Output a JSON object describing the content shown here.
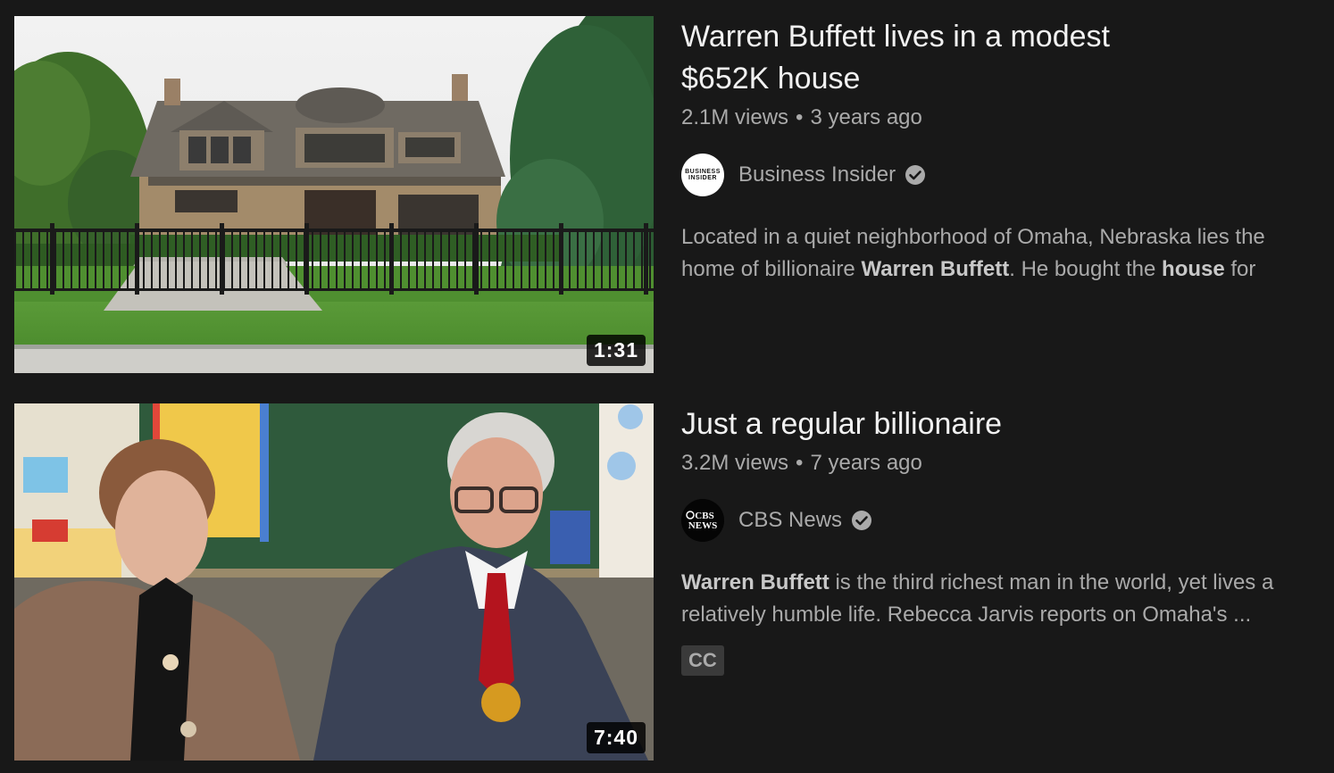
{
  "videos": [
    {
      "title_line1": "Warren Buffett lives in a modest",
      "title_line2": "$652K house",
      "views": "2.1M views",
      "separator": "•",
      "age": "3 years ago",
      "channel": "Business Insider",
      "avatar_text_line1": "BUSINESS",
      "avatar_text_line2": "INSIDER",
      "verified_icon": "verified-check-icon",
      "description_parts": [
        "Located in a quiet neighborhood of Omaha, Nebraska lies the home of billionaire ",
        "Warren Buffett",
        ". He bought the ",
        "house",
        " for"
      ],
      "duration": "1:31"
    },
    {
      "title_line1": "Just a regular billionaire",
      "views": "3.2M views",
      "separator": "•",
      "age": "7 years ago",
      "channel": "CBS News",
      "avatar_text_line1": "CBS",
      "avatar_text_line2": "NEWS",
      "verified_icon": "verified-check-icon",
      "description_parts": [
        "Warren Buffett",
        " is the third richest man in the world, yet lives a relatively humble life. Rebecca Jarvis reports on Omaha's ..."
      ],
      "badge": "CC",
      "duration": "7:40"
    }
  ],
  "colors": {
    "background": "#181818",
    "title": "#f1f1f1",
    "secondary_text": "#aaaaaa",
    "badge_bg": "#3a3a3a"
  }
}
